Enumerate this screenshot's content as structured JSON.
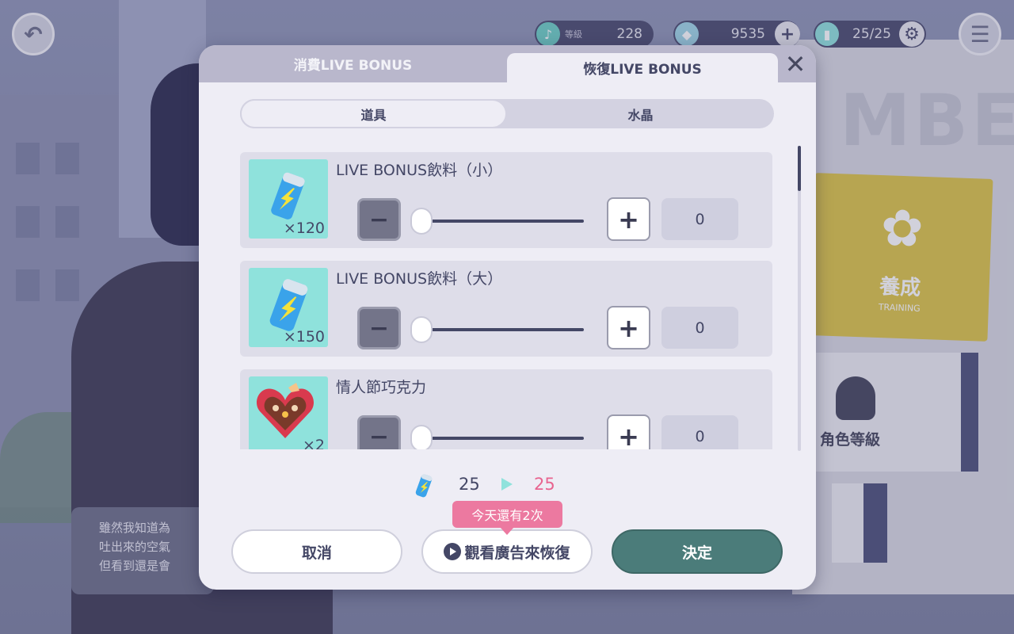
{
  "hud": {
    "level_label": "等級",
    "level_value": "228",
    "crystal_value": "9535",
    "energy_value": "25/25"
  },
  "background": {
    "board_title": "MBER",
    "training_card": {
      "title": "養成",
      "subtitle": "TRAINING"
    },
    "character_rank_label": "角色等級",
    "dialogue": "雖然我知道為\n吐出來的空氣\n但看到還是會"
  },
  "modal": {
    "tabs": [
      {
        "label": "消費LIVE BONUS",
        "active": false
      },
      {
        "label": "恢復LIVE BONUS",
        "active": true
      }
    ],
    "segment": [
      {
        "label": "道具",
        "active": true
      },
      {
        "label": "水晶",
        "active": false
      }
    ],
    "items": [
      {
        "name": "LIVE BONUS飲料（小）",
        "owned": "×120",
        "selected": "0",
        "icon": "energy-drink-small-icon"
      },
      {
        "name": "LIVE BONUS飲料（大）",
        "owned": "×150",
        "selected": "0",
        "icon": "energy-drink-large-icon"
      },
      {
        "name": "情人節巧克力",
        "owned": "×2",
        "selected": "0",
        "icon": "valentine-chocolate-icon"
      }
    ],
    "energy": {
      "from": "25",
      "to": "25"
    },
    "ad_badge": "今天還有2次",
    "buttons": {
      "cancel": "取消",
      "watch_ad": "觀看廣告來恢復",
      "confirm": "決定"
    }
  },
  "colors": {
    "accent_teal": "#4b7c7a",
    "pink": "#ec79a0",
    "item_bg": "#8fe2dc"
  }
}
